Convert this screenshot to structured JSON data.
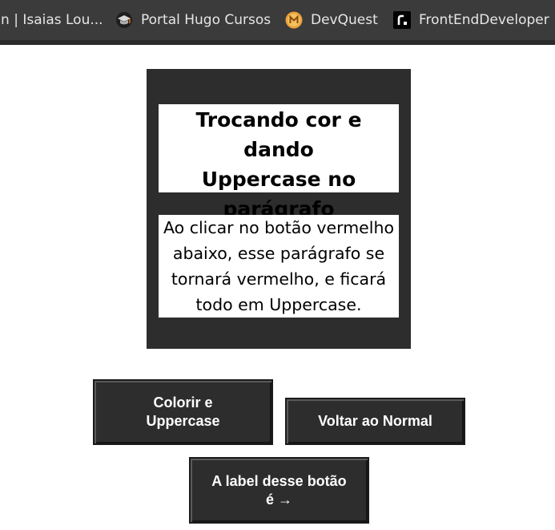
{
  "bookmarks": [
    {
      "label": "In | Isaias Lou...",
      "icon": "linkedin-icon"
    },
    {
      "label": "Portal Hugo Cursos",
      "icon": "graduation-cap-icon"
    },
    {
      "label": "DevQuest",
      "icon": "devquest-logo-icon"
    },
    {
      "label": "FrontEndDeveloper",
      "icon": "frontend-logo-icon"
    }
  ],
  "card": {
    "title_lines": [
      "Trocando cor e dando",
      "Uppercase no",
      "parágrafo"
    ],
    "paragraph_lines": [
      "Ao clicar no botão vermelho",
      "abaixo, esse parágrafo se",
      "tornará vermelho, e ficará",
      "todo em Uppercase."
    ]
  },
  "buttons": {
    "colorir_lines": [
      "Colorir e",
      "Uppercase"
    ],
    "voltar": "Voltar ao Normal",
    "label_lines": [
      "A label desse botão",
      "é →"
    ]
  },
  "colors": {
    "bookmarks_bg": "#3b3b3b",
    "card_bg": "#2d2d2d",
    "button_bg": "#2d2d2d",
    "devquest_accent": "#e8a33c"
  }
}
